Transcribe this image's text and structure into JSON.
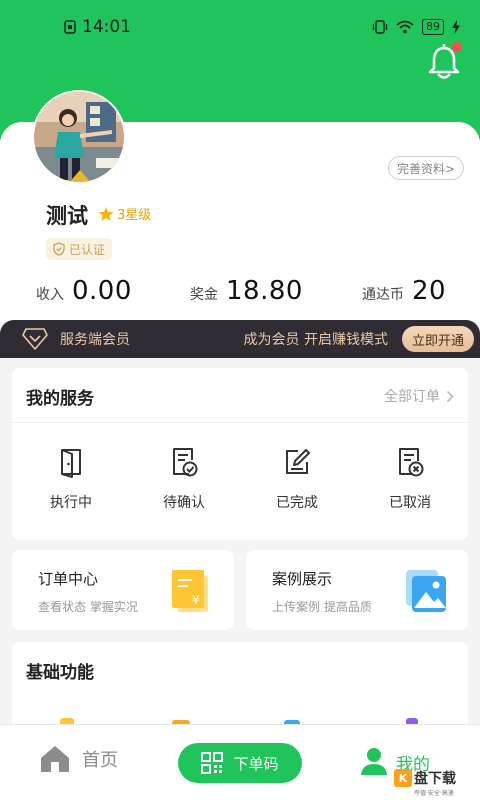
{
  "status_bar": {
    "time": "14:01",
    "battery": "89"
  },
  "profile": {
    "complete_label": "完善资料>",
    "username": "测试",
    "star_level": "3星级",
    "verified": "已认证"
  },
  "stats": [
    {
      "label": "收入",
      "value": "0.00"
    },
    {
      "label": "奖金",
      "value": "18.80"
    },
    {
      "label": "通达币",
      "value": "20"
    }
  ],
  "vip": {
    "title": "服务端会员",
    "slogan": "成为会员  开启赚钱模式",
    "button": "立即开通"
  },
  "services": {
    "title": "我的服务",
    "all_orders": "全部订单",
    "items": [
      {
        "label": "执行中",
        "icon": "executing-icon"
      },
      {
        "label": "待确认",
        "icon": "pending-confirm-icon"
      },
      {
        "label": "已完成",
        "icon": "completed-icon"
      },
      {
        "label": "已取消",
        "icon": "cancelled-icon"
      }
    ]
  },
  "order_center": {
    "title": "订单中心",
    "subtitle": "查看状态  掌握实况"
  },
  "case_show": {
    "title": "案例展示",
    "subtitle": "上传案例  提高品质"
  },
  "basic": {
    "title": "基础功能"
  },
  "tabbar": {
    "home": "首页",
    "order": "下单码",
    "me": "我的"
  },
  "watermark": {
    "brand": "盘下载",
    "k": "K",
    "tagline": "夸值·安全·高速"
  },
  "colors": {
    "primary": "#1fc55a",
    "vip_bg": "#2f2d33",
    "vip_text": "#e9c9a8"
  }
}
